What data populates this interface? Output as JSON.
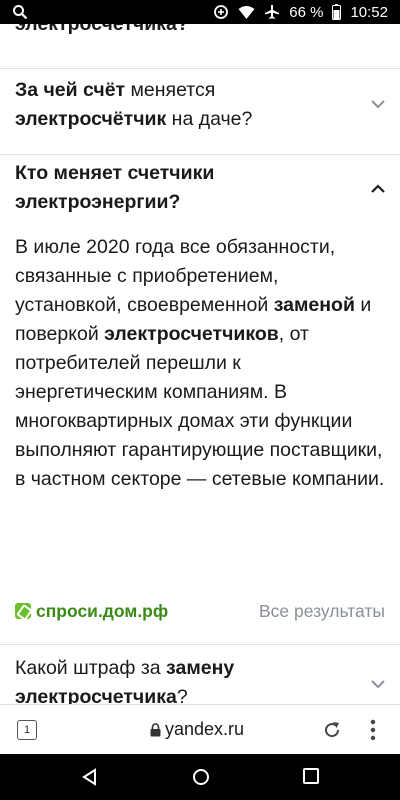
{
  "status_bar": {
    "battery_percent": "66 %",
    "time": "10:52",
    "icons": [
      "search-icon",
      "data-saver-icon",
      "wifi-icon",
      "airplane-icon",
      "battery-icon"
    ]
  },
  "faq": {
    "item0": {
      "question_tail": "электросчетчика?"
    },
    "item1": {
      "q_part1": "За чей счёт",
      "q_part2": " меняется ",
      "q_part3": "электросчётчик",
      "q_part4": " на даче?",
      "expanded": false
    },
    "item2": {
      "question_line1": "Кто меняет счетчики",
      "question_line2": "электроэнергии?",
      "expanded": true,
      "answer": {
        "p1": "В июле 2020 года все обязанности, связанные с приобретением, установкой, своевременной ",
        "b1": "заменой",
        "p2": " и поверкой ",
        "b2": "электросчетчиков",
        "p3": ", от потребителей перешли к энергетическим компаниям. В многоквартирных домах эти функции выполняют гарантирующие поставщики, в частном секторе — сетевые компании."
      },
      "source_name": "спроси.дом.рф",
      "all_results": "Все результаты"
    },
    "item3": {
      "q_part1": "Какой штраф за ",
      "q_part2": "замену",
      "q_part3": "электросчетчика",
      "q_part4": "?",
      "expanded": false
    }
  },
  "browser": {
    "tab_count": "1",
    "url": "yandex.ru"
  },
  "colors": {
    "source_green": "#3a8a17",
    "muted_gray": "#8a8f9a",
    "divider": "#e3e3e3"
  }
}
